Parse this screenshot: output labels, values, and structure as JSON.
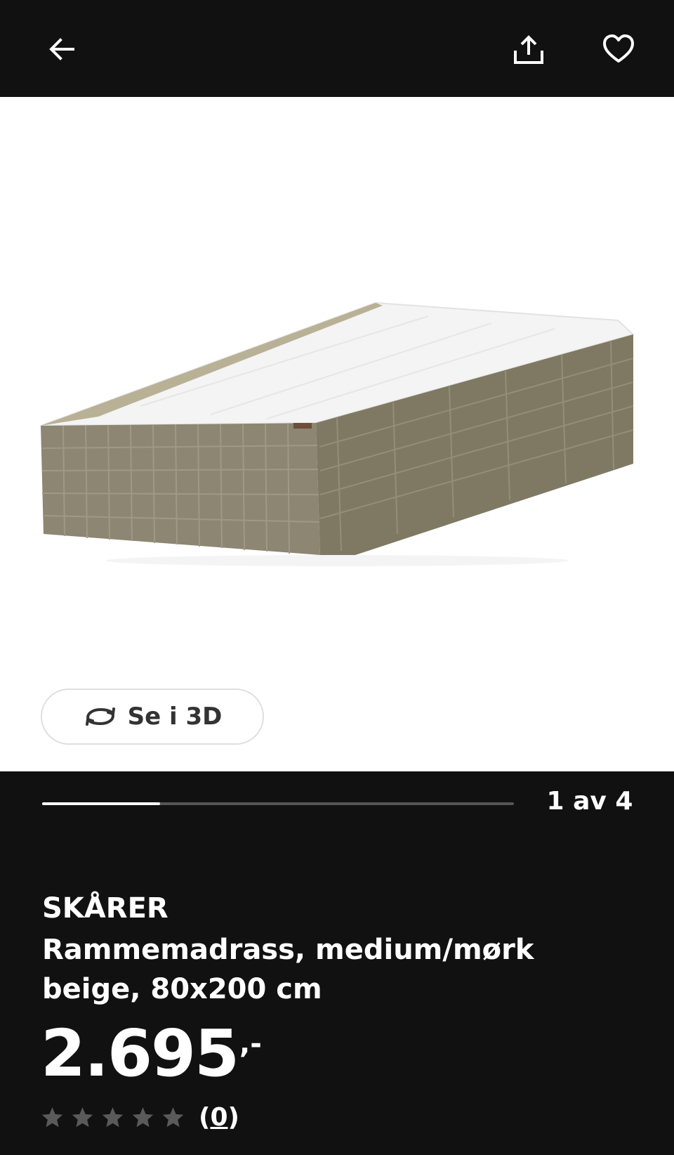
{
  "header": {
    "back_icon": "arrow-left-icon",
    "share_icon": "share-upload-icon",
    "favorite_icon": "heart-outline-icon"
  },
  "gallery": {
    "image_icon": "product-image",
    "view_3d_label": "Se i 3D",
    "view_3d_icon": "rotate-3d-icon",
    "page_counter": "1 av 4",
    "progress_fraction": 0.25
  },
  "product": {
    "brand": "SKÅRER",
    "description": "Rammemadrass, medium/mørk beige, 80x200 cm",
    "price_main": "2.695",
    "price_suffix": ",-",
    "rating": {
      "stars_filled": 0,
      "stars_total": 5,
      "review_open": "(",
      "review_count": "0",
      "review_close": ")"
    }
  },
  "colors": {
    "background": "#111111",
    "mattress_fabric": "#8c8672",
    "mattress_top": "#f4f4f4"
  }
}
